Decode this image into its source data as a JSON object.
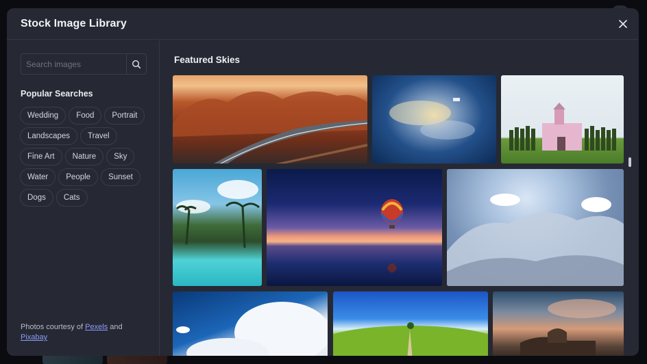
{
  "modal": {
    "title": "Stock Image Library",
    "close_icon": "close-icon"
  },
  "sidebar": {
    "search": {
      "placeholder": "Search images",
      "value": "",
      "icon": "search-icon"
    },
    "popular_title": "Popular Searches",
    "tags": [
      [
        "Wedding",
        "Food",
        "Portrait"
      ],
      [
        "Landscapes",
        "Travel"
      ],
      [
        "Fine Art",
        "Nature",
        "Sky"
      ],
      [
        "Water",
        "People",
        "Sunset"
      ],
      [
        "Dogs",
        "Cats"
      ]
    ],
    "credits": {
      "prefix": "Photos courtesy of",
      "link1": "Pexels",
      "middle": "and",
      "link2": "Pixabay"
    }
  },
  "content": {
    "section_title": "Featured Skies"
  },
  "colors": {
    "modal_bg": "#262933",
    "backdrop": "#0b0c10",
    "link": "#8e9cff",
    "border": "#3a3e4b"
  }
}
